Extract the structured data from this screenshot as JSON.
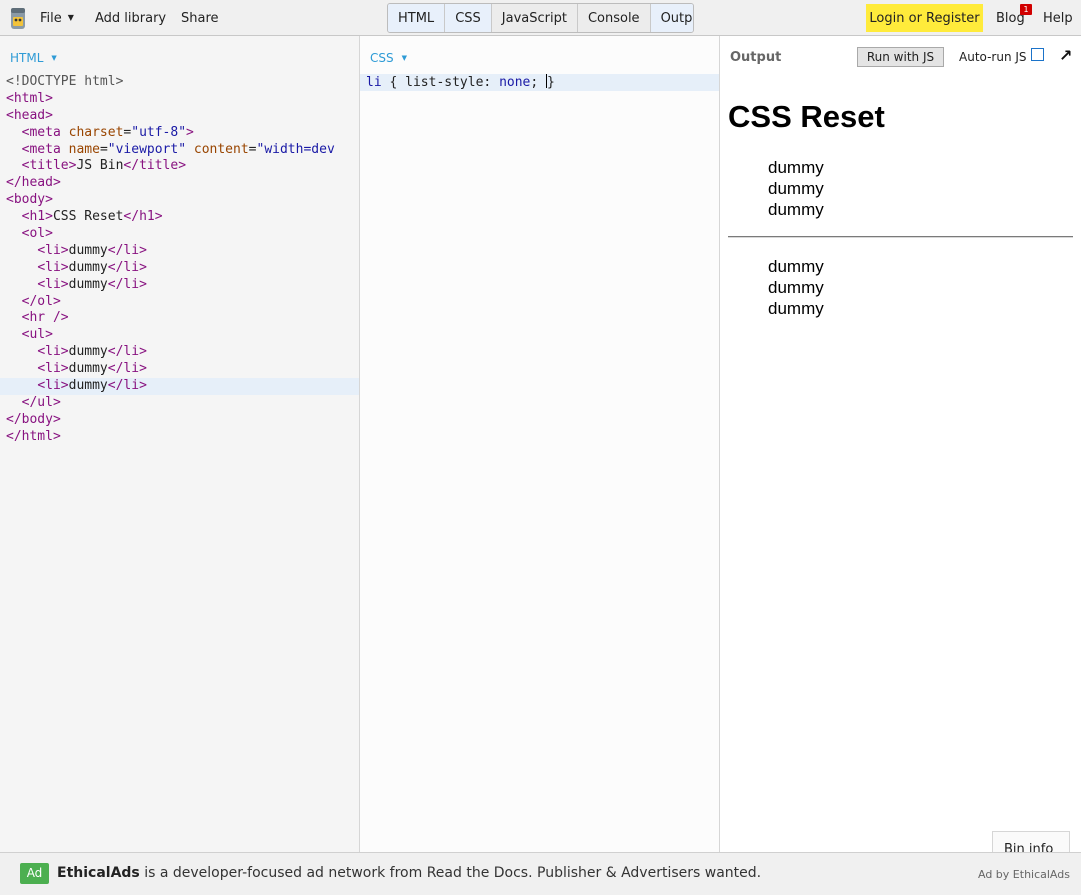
{
  "toolbar": {
    "file_label": "File",
    "add_library_label": "Add library",
    "share_label": "Share",
    "panel_toggles": [
      {
        "label": "HTML",
        "active": true
      },
      {
        "label": "CSS",
        "active": true
      },
      {
        "label": "JavaScript",
        "active": false
      },
      {
        "label": "Console",
        "active": false
      },
      {
        "label": "Output",
        "active": true
      }
    ],
    "login_label": "Login or Register",
    "blog_label": "Blog",
    "blog_badge": "1",
    "help_label": "Help"
  },
  "html_panel": {
    "label": "HTML",
    "lines": [
      "<!DOCTYPE html>",
      "<html>",
      "<head>",
      "  <meta charset=\"utf-8\">",
      "  <meta name=\"viewport\" content=\"width=dev",
      "  <title>JS Bin</title>",
      "</head>",
      "<body>",
      "  <h1>CSS Reset</h1>",
      "  <ol>",
      "    <li>dummy</li>",
      "    <li>dummy</li>",
      "    <li>dummy</li>",
      "  </ol>",
      "  <hr />",
      "  <ul>",
      "    <li>dummy</li>",
      "    <li>dummy</li>",
      "    <li>dummy</li>",
      "  </ul>",
      "</body>",
      "</html>"
    ],
    "highlighted_line": 18
  },
  "css_panel": {
    "label": "CSS",
    "code": "li { list-style: none; }"
  },
  "output_panel": {
    "label": "Output",
    "run_button_label": "Run with JS",
    "autorun_label": "Auto-run JS",
    "autorun_checked": false,
    "preview": {
      "heading": "CSS Reset",
      "ordered_items": [
        "dummy",
        "dummy",
        "dummy"
      ],
      "unordered_items": [
        "dummy",
        "dummy",
        "dummy"
      ]
    },
    "bin_info_label": "Bin info"
  },
  "ad": {
    "badge": "Ad",
    "brand": "EthicalAds",
    "text": " is a developer-focused ad network from Read the Docs. Publisher & Advertisers wanted.",
    "by_label": "Ad by EthicalAds"
  },
  "colors": {
    "accent_blue": "#2e9bd6",
    "login_yellow": "#ffeb3b",
    "ad_green": "#4caf50",
    "blog_badge_red": "#d10000"
  },
  "icons": {
    "logo": "jsbin-logo-icon",
    "popout": "popout-arrow-icon",
    "caret": "caret-down-icon"
  }
}
